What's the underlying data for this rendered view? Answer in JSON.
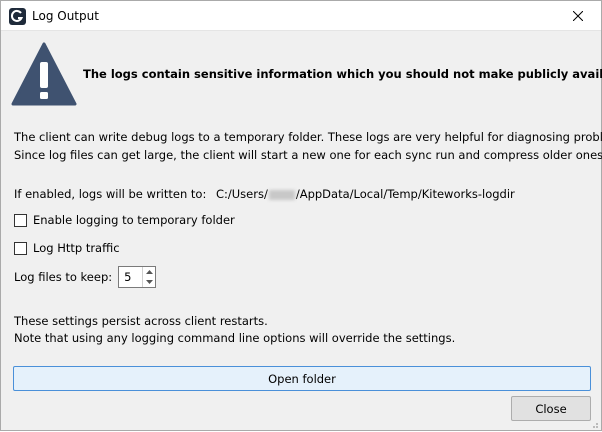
{
  "window": {
    "title": "Log Output"
  },
  "warning": {
    "text": "The logs contain sensitive information which you should not make publicly available"
  },
  "description": {
    "line1": "The client can write debug logs to a temporary folder. These logs are very helpful for diagnosing problems.",
    "line2": "Since log files can get large, the client will start a new one for each sync run and compress older ones."
  },
  "path": {
    "label": "If enabled, logs will be written to:",
    "prefix": "C:/Users/",
    "suffix": "/AppData/Local/Temp/Kiteworks-logdir"
  },
  "options": {
    "enable_logging": "Enable logging to temporary folder",
    "log_http": "Log Http traffic"
  },
  "keep": {
    "label": "Log files to keep:",
    "value": "5"
  },
  "notes": {
    "line1": "These settings persist across client restarts.",
    "line2": "Note that using any logging command line options will override the settings."
  },
  "buttons": {
    "open_folder": "Open folder",
    "close": "Close"
  },
  "colors": {
    "warning_icon": "#3f5270",
    "accent_button_border": "#4a90d9"
  }
}
